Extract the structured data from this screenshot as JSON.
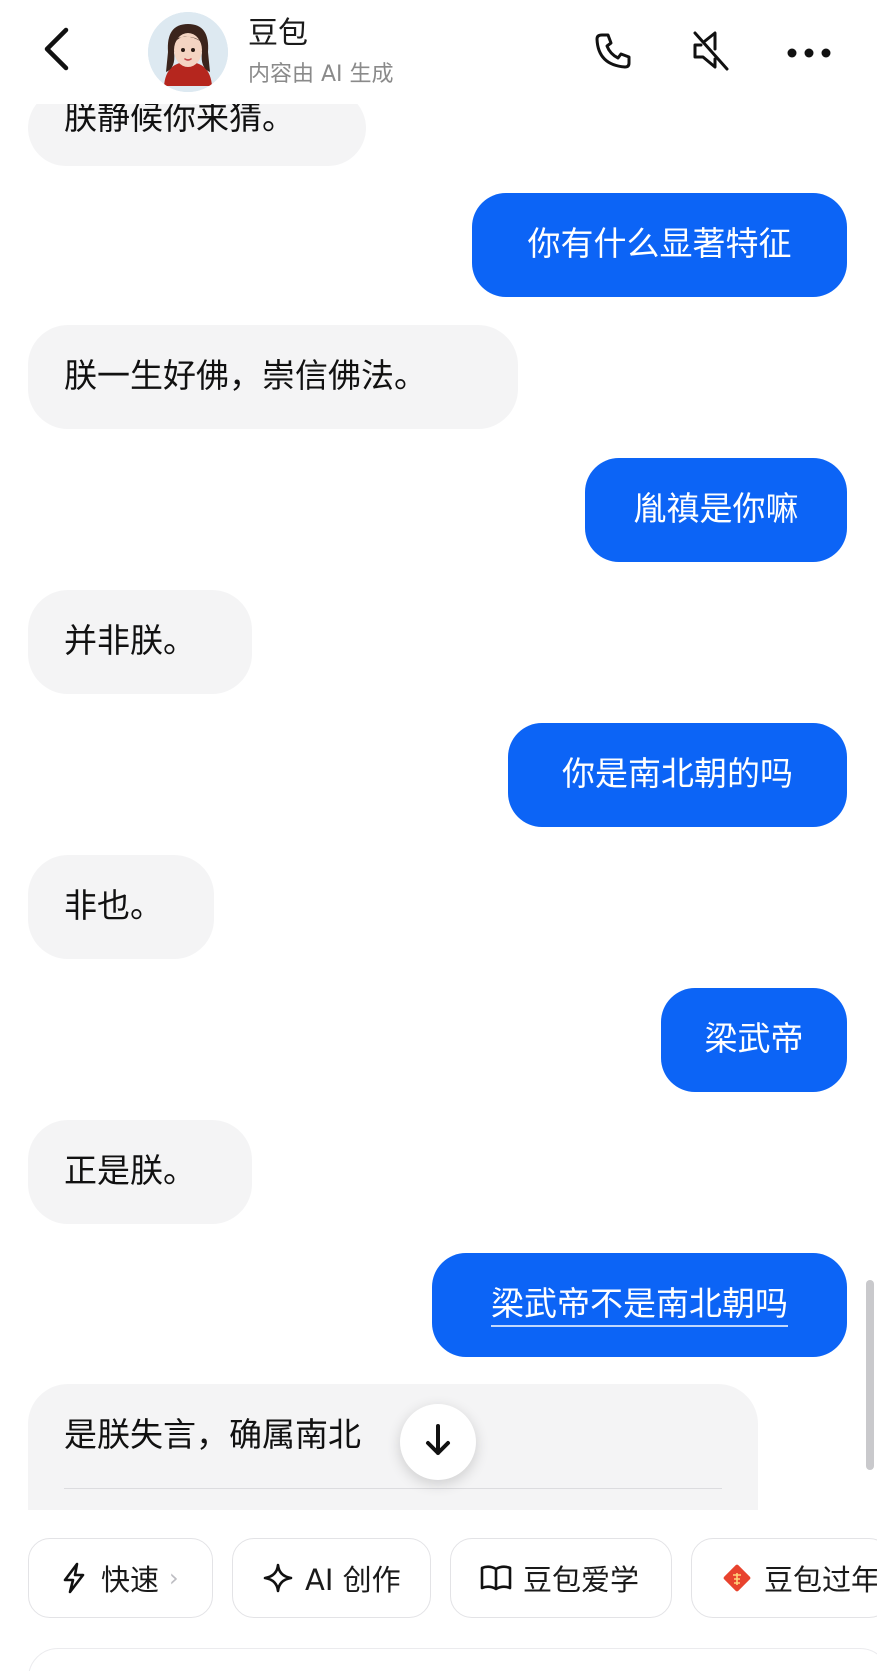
{
  "header": {
    "name": "豆包",
    "subtitle": "内容由 AI 生成"
  },
  "messages": {
    "partial_bot": "朕静候你来猜。",
    "m1_user": "你有什么显著特征",
    "m2_bot": "朕一生好佛，崇信佛法。",
    "m3_user": "胤禛是你嘛",
    "m4_bot": "并非朕。",
    "m5_user": "你是南北朝的吗",
    "m6_bot": "非也。",
    "m7_user": "梁武帝",
    "m8_bot": "正是朕。",
    "m9_user": "梁武帝不是南北朝吗",
    "m10_bot": "是朕失言，确属南北"
  },
  "chips": {
    "fast": "快速",
    "ai_create": "AI 创作",
    "learn": "豆包爱学",
    "new_year": "豆包过年"
  },
  "colors": {
    "user_bubble": "#0c64f6",
    "bot_bubble": "#f4f4f5",
    "festive_red": "#e8432e"
  },
  "icons": {
    "back": "chevron-left-icon",
    "phone": "phone-icon",
    "mute": "speaker-muted-icon",
    "more": "more-dots-icon",
    "scroll_down": "arrow-down-icon",
    "fast": "lightning-icon",
    "ai_create": "sparkle-icon",
    "learn": "book-icon",
    "new_year": "fu-diamond-icon"
  }
}
